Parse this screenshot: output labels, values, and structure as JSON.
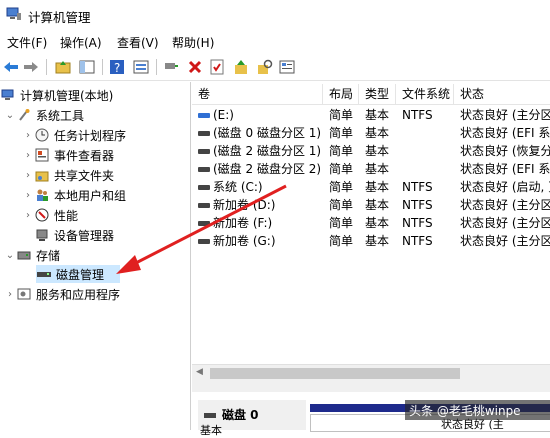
{
  "window": {
    "title": "计算机管理"
  },
  "menu": [
    "文件(F)",
    "操作(A)",
    "查看(V)",
    "帮助(H)"
  ],
  "tree": {
    "root": "计算机管理(本地)",
    "system_tools": "系统工具",
    "task_scheduler": "任务计划程序",
    "event_viewer": "事件查看器",
    "shared_folders": "共享文件夹",
    "local_users": "本地用户和组",
    "performance": "性能",
    "device_manager": "设备管理器",
    "storage": "存储",
    "disk_management": "磁盘管理",
    "services": "服务和应用程序"
  },
  "table": {
    "columns": [
      "卷",
      "布局",
      "类型",
      "文件系统",
      "状态"
    ],
    "rows": [
      [
        "(E:)",
        "简单",
        "基本",
        "NTFS",
        "状态良好 (主分区"
      ],
      [
        "(磁盘 0 磁盘分区 1)",
        "简单",
        "基本",
        "",
        "状态良好 (EFI 系"
      ],
      [
        "(磁盘 2 磁盘分区 1)",
        "简单",
        "基本",
        "",
        "状态良好 (恢复分"
      ],
      [
        "(磁盘 2 磁盘分区 2)",
        "简单",
        "基本",
        "",
        "状态良好 (EFI 系"
      ],
      [
        "系统 (C:)",
        "简单",
        "基本",
        "NTFS",
        "状态良好 (启动, 页"
      ],
      [
        "新加卷 (D:)",
        "简单",
        "基本",
        "NTFS",
        "状态良好 (主分区"
      ],
      [
        "新加卷 (F:)",
        "简单",
        "基本",
        "NTFS",
        "状态良好 (主分区"
      ],
      [
        "新加卷 (G:)",
        "简单",
        "基本",
        "NTFS",
        "状态良好 (主分区"
      ]
    ]
  },
  "bottom": {
    "disk_label": "磁盘 0",
    "disk_type": "基本",
    "partition_text": "状态良好 (主"
  },
  "watermark": "头条 @老毛桃winpe",
  "colors": {
    "accent": "#2f6fd4",
    "selected": "#cce8ff",
    "arrow": "#e02020"
  }
}
